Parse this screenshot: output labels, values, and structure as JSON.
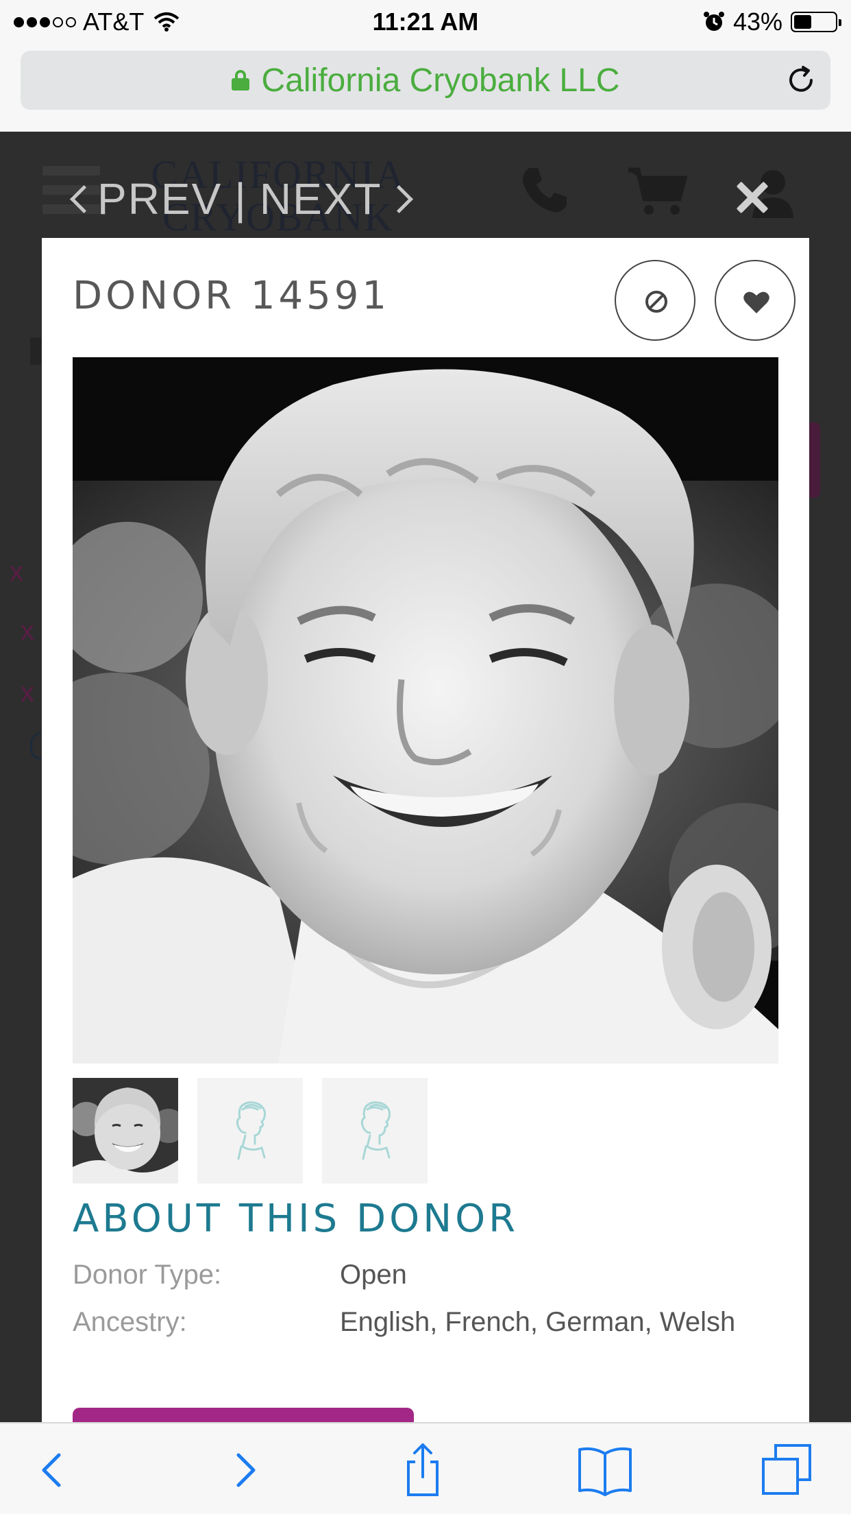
{
  "status_bar": {
    "carrier": "AT&T",
    "signal_bars_filled": 3,
    "signal_bars_total": 5,
    "time": "11:21 AM",
    "battery_percent": "43%",
    "battery_level": 0.43,
    "icons": [
      "wifi-icon",
      "alarm-icon",
      "battery-icon"
    ]
  },
  "browser": {
    "site_title": "California Cryobank LLC",
    "secure": true,
    "icons": [
      "lock-icon",
      "reload-icon"
    ],
    "accent_color": "#4aad3e"
  },
  "background_page": {
    "logo_text_line1": "CALIFORNIA",
    "logo_text_line2": "CRYOBANK",
    "icons": [
      "hamburger-menu-icon",
      "phone-icon",
      "cart-icon",
      "user-icon"
    ]
  },
  "modal_nav": {
    "prev_label": "PREV",
    "separator": "|",
    "next_label": "NEXT",
    "close_icon": "close-icon"
  },
  "donor": {
    "title": "DONOR 14591",
    "actions": [
      {
        "name": "hide-donor",
        "icon": "block-icon"
      },
      {
        "name": "favorite-donor",
        "icon": "heart-icon"
      }
    ],
    "photos": [
      {
        "type": "photo",
        "active": true
      },
      {
        "type": "placeholder",
        "icon": "child-silhouette-icon"
      },
      {
        "type": "placeholder",
        "icon": "child-silhouette-icon"
      }
    ]
  },
  "about": {
    "heading": "ABOUT THIS DONOR",
    "rows": [
      {
        "label": "Donor Type:",
        "value": "Open"
      },
      {
        "label": "Ancestry:",
        "value": "English, French, German, Welsh"
      }
    ],
    "button_color": "#a32786"
  },
  "toolbar": {
    "icons": [
      "back-icon",
      "forward-icon",
      "share-icon",
      "bookmarks-icon",
      "tabs-icon"
    ],
    "tint_color": "#1c7cf0"
  }
}
